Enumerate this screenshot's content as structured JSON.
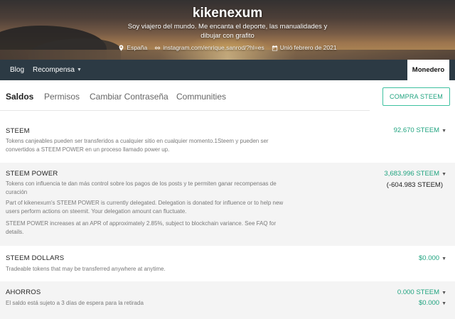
{
  "profile": {
    "username": "kikenexum",
    "about": "Soy viajero del mundo. Me encanta el deporte, las manualidades y dibujar con grafito",
    "location": "España",
    "website": "instagram.com/enrique.sanrod/?hl=es",
    "joined": "Unió febrero de 2021"
  },
  "nav": {
    "blog": "Blog",
    "rewards": "Recompensa",
    "wallet": "Monedero"
  },
  "tabs": [
    {
      "label": "Saldos",
      "active": true
    },
    {
      "label": "Permisos",
      "active": false
    },
    {
      "label": "Cambiar Contraseña",
      "active": false
    },
    {
      "label": "Communities",
      "active": false
    }
  ],
  "buy_button": "COMPRA STEEM",
  "balances": {
    "steem": {
      "title": "STEEM",
      "desc_1": "Tokens canjeables pueden ser transferidos a cualquier sitio en cualquier momento.1Steem y pueden ser",
      "desc_2": "convertidos a STEEM POWER en un proceso llamado power up.",
      "amount": "92.670 STEEM"
    },
    "steem_power": {
      "title": "STEEM POWER",
      "desc_1": "Tokens con influencia te dan más control sobre los pagos de los posts y te permiten ganar recompensas de",
      "desc_2": "curación",
      "desc_3": "Part of kikenexum's STEEM POWER is currently delegated. Delegation is donated for influence or to help new",
      "desc_4": "users perform actions on steemit. Your delegation amount can fluctuate.",
      "desc_5": "STEEM POWER increases at an APR of approximately 2.85%, subject to blockchain variance. See FAQ for",
      "desc_6": "details.",
      "amount": "3,683.996 STEEM",
      "delegated": "(-604.983 STEEM)"
    },
    "steem_dollars": {
      "title": "STEEM DOLLARS",
      "desc_1": "Tradeable tokens that may be transferred anywhere at anytime.",
      "amount": "$0.000"
    },
    "savings": {
      "title": "AHORROS",
      "desc_1": "El saldo está sujeto a 3 días de espera para la retirada",
      "amount_steem": "0.000 STEEM",
      "amount_sbd": "$0.000"
    }
  },
  "colors": {
    "accent": "#1fa37f",
    "nav_bg": "#2c3a44",
    "row_shade": "#f4f4f4"
  }
}
